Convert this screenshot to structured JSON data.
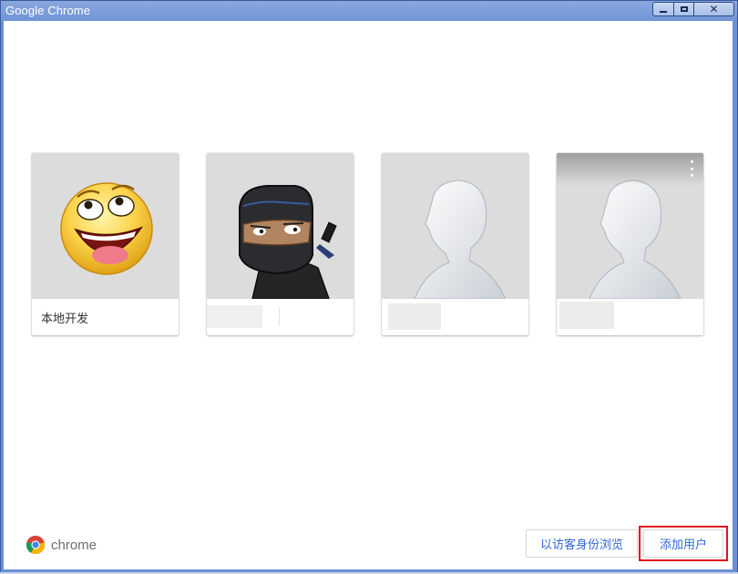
{
  "window": {
    "title": "Google Chrome",
    "controls": {
      "minimize": "minimize",
      "maximize": "maximize",
      "close": "✕"
    }
  },
  "profiles": [
    {
      "name": "本地开发",
      "avatar": "smiley-face-avatar"
    },
    {
      "name": "",
      "avatar": "ninja-avatar"
    },
    {
      "name": "",
      "avatar": "mannequin-avatar"
    },
    {
      "name": "",
      "avatar": "mannequin-avatar",
      "has_menu": true
    }
  ],
  "footer": {
    "brand": "chrome",
    "guest_button": "以访客身份浏览",
    "add_user_button": "添加用户"
  },
  "colors": {
    "accent": "#3367d6",
    "highlight": "#e0141e",
    "avatar_bg": "#dcdcdc"
  }
}
